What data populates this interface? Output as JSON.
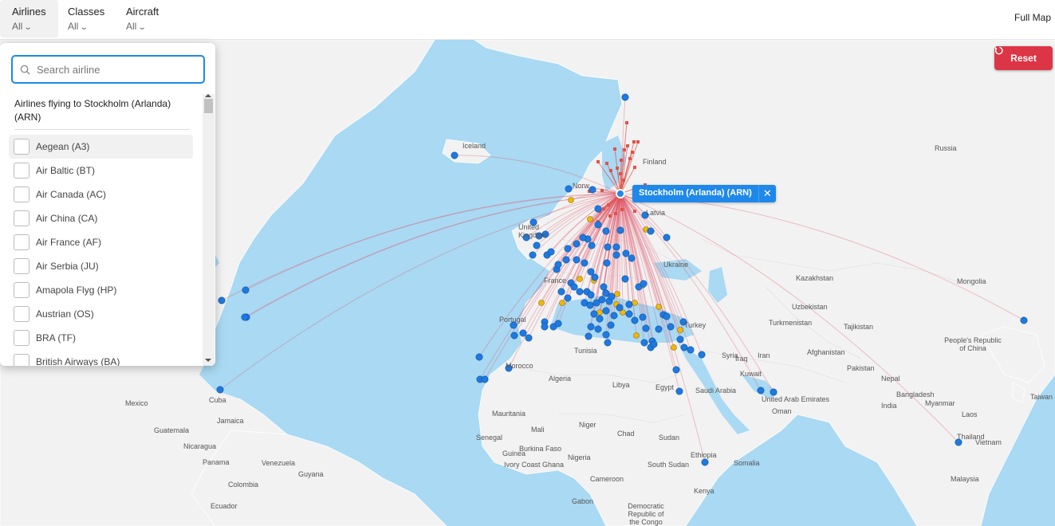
{
  "filters": {
    "airlines": {
      "label": "Airlines",
      "value": "All"
    },
    "classes": {
      "label": "Classes",
      "value": "All"
    },
    "aircraft": {
      "label": "Aircraft",
      "value": "All"
    }
  },
  "full_map_label": "Full Map",
  "reset_label": "Reset",
  "selected_airport": "Stockholm (Arlanda) (ARN)",
  "dropdown": {
    "search_placeholder": "Search airline",
    "list_title": "Airlines flying to Stockholm (Arlanda) (ARN)",
    "airlines": [
      "Aegean (A3)",
      "Air Baltic (BT)",
      "Air Canada (AC)",
      "Air China (CA)",
      "Air France (AF)",
      "Air Serbia (JU)",
      "Amapola Flyg (HP)",
      "Austrian (OS)",
      "BRA (TF)",
      "British Airways (BA)"
    ]
  },
  "map_labels": [
    "Iceland",
    "Finland",
    "Norw",
    "Russia",
    "United Kingdom",
    "France",
    "Ukraine",
    "Kazakhstan",
    "Mongolia",
    "Uzbekistan",
    "Turkmenistan",
    "Tajikistan",
    "People's Republic of China",
    "Turkey",
    "Syria",
    "Iraq",
    "Iran",
    "Afghanistan",
    "Pakistan",
    "Portugal",
    "Tunisia",
    "Morocco",
    "Algeria",
    "Libya",
    "Egypt",
    "Saudi Arabia",
    "Kuwait",
    "United Arab Emirates",
    "Oman",
    "India",
    "Nepal",
    "Bangladesh",
    "Myanmar",
    "Laos",
    "Thailand",
    "Vietnam",
    "Taiwan",
    "Mauritania",
    "Mali",
    "Niger",
    "Chad",
    "Sudan",
    "Senegal",
    "Guinea",
    "Burkina Faso",
    "Ivory Coast",
    "Ghana",
    "Nigeria",
    "Cameroon",
    "Ethiopia",
    "Somalia",
    "South Sudan",
    "Kenya",
    "Democratic Republic of the Congo",
    "Gabon",
    "Malaysia",
    "Mexico",
    "Cuba",
    "Jamaica",
    "Guatemala",
    "Nicaragua",
    "Panama",
    "Venezuela",
    "Colombia",
    "Guyana",
    "Ecuador",
    "Latvia"
  ],
  "colors": {
    "accent": "#1f88e8",
    "reset": "#dc3545",
    "route": "#e0576b",
    "domestic": "#e0524a",
    "seasonal": "#f2b705",
    "water": "#a9d9f3",
    "land": "#f2f2f2"
  },
  "icons": [
    "search-icon",
    "chevron-down-icon",
    "reset-icon",
    "close-icon"
  ]
}
